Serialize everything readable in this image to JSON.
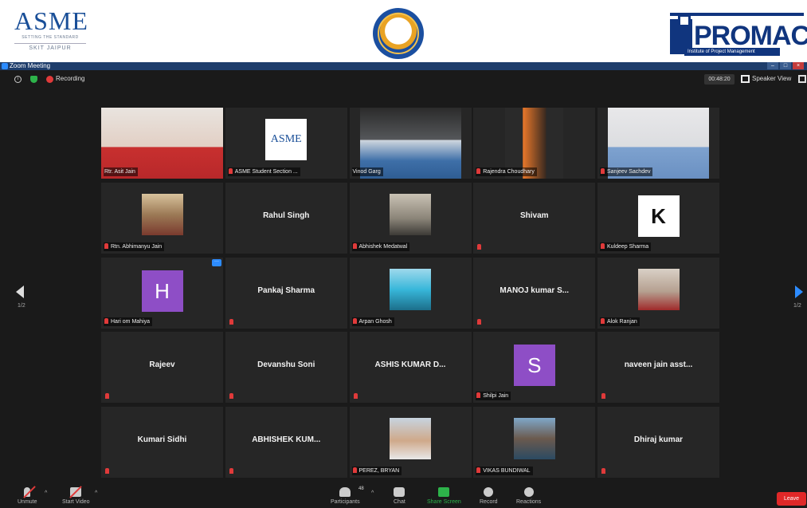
{
  "banner": {
    "asme_logo_text": "ASME",
    "asme_tagline": "SETTING THE STANDARD",
    "asme_section": "SKIT JAIPUR",
    "promac_word": "PROMAC",
    "promac_tagline": "Institute of Project Management"
  },
  "window": {
    "title": "Zoom Meeting"
  },
  "topbar": {
    "recording_label": "Recording",
    "timer": "00:48:20",
    "view_label": "Speaker View"
  },
  "paging": {
    "prev_page": "1/2",
    "next_page": "1/2"
  },
  "participants": [
    {
      "name": "Rtr. Asit Jain",
      "muted": false,
      "kind": "video",
      "active": true
    },
    {
      "name": "ASME Student Section ...",
      "muted": true,
      "kind": "logo"
    },
    {
      "name": "Vinod Garg",
      "muted": false,
      "kind": "video"
    },
    {
      "name": "Rajendra Choudhary",
      "muted": true,
      "kind": "video"
    },
    {
      "name": "Sanjeev Sachdev",
      "muted": true,
      "kind": "video"
    },
    {
      "name": "Rtn. Abhimanyu Jain",
      "muted": true,
      "kind": "photo"
    },
    {
      "name": "Rahul Singh",
      "muted": false,
      "kind": "name"
    },
    {
      "name": "Abhishek Medatwal",
      "muted": true,
      "kind": "photo"
    },
    {
      "name": "Shivam",
      "muted": true,
      "kind": "name"
    },
    {
      "name": "Kuldeep Sharma",
      "muted": true,
      "kind": "letter",
      "letter": "K",
      "color": "#ffffff"
    },
    {
      "name": "Hari om Mahiya",
      "muted": true,
      "kind": "letter",
      "letter": "H",
      "color": "#8e4ec6"
    },
    {
      "name": "Pankaj Sharma",
      "muted": true,
      "kind": "name"
    },
    {
      "name": "Arpan Ghosh",
      "muted": true,
      "kind": "photo"
    },
    {
      "name": "MANOJ kumar S...",
      "muted": true,
      "kind": "name"
    },
    {
      "name": "Alok Ranjan",
      "muted": true,
      "kind": "photo"
    },
    {
      "name": "Rajeev",
      "muted": true,
      "kind": "name"
    },
    {
      "name": "Devanshu Soni",
      "muted": true,
      "kind": "name"
    },
    {
      "name": "ASHIS KUMAR D...",
      "muted": true,
      "kind": "name"
    },
    {
      "name": "Shilpi Jain",
      "muted": true,
      "kind": "letter",
      "letter": "S",
      "color": "#8e4ec6"
    },
    {
      "name": "naveen jain asst...",
      "muted": true,
      "kind": "name"
    },
    {
      "name": "Kumari Sidhi",
      "muted": true,
      "kind": "name"
    },
    {
      "name": "ABHISHEK KUM...",
      "muted": true,
      "kind": "name"
    },
    {
      "name": "PEREZ, BRYAN",
      "muted": true,
      "kind": "photo"
    },
    {
      "name": "VIKAS BUNDIWAL",
      "muted": true,
      "kind": "photo"
    },
    {
      "name": "Dhiraj kumar",
      "muted": true,
      "kind": "name"
    }
  ],
  "toolbar": {
    "unmute_label": "Unmute",
    "start_video_label": "Start Video",
    "participants_label": "Participants",
    "participants_count": "48",
    "chat_label": "Chat",
    "share_screen_label": "Share Screen",
    "record_label": "Record",
    "reactions_label": "Reactions",
    "leave_label": "Leave"
  },
  "colors": {
    "active_speaker": "#c8dc37",
    "zoom_blue": "#2d8cff",
    "share_green": "#2db34a",
    "leave_red": "#e02828"
  }
}
